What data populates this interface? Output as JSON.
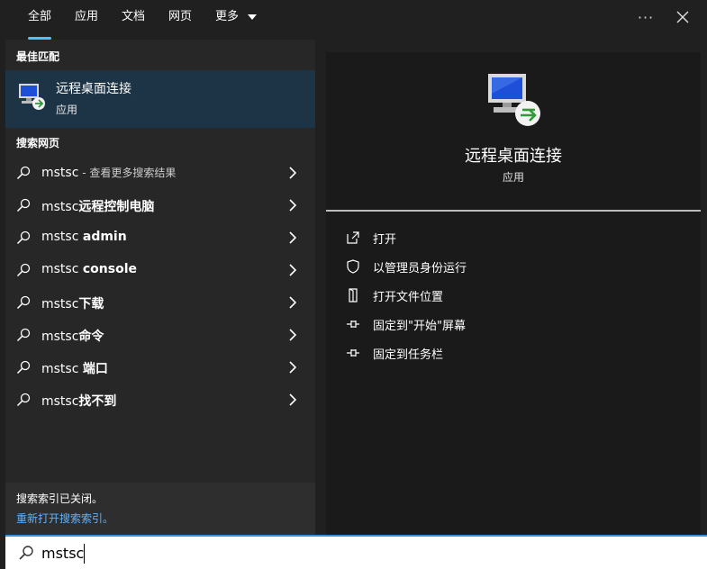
{
  "tabs": [
    {
      "label": "全部"
    },
    {
      "label": "应用"
    },
    {
      "label": "文档"
    },
    {
      "label": "网页"
    },
    {
      "label": "更多"
    }
  ],
  "top_actions": {
    "more": "···"
  },
  "best_match": {
    "section_title": "最佳匹配",
    "name": "远程桌面连接",
    "type": "应用"
  },
  "web": {
    "section_title": "搜索网页",
    "items": [
      {
        "query": "mstsc",
        "suffix": " - 查看更多搜索结果"
      },
      {
        "query": "mstsc",
        "bold": "远程控制电脑"
      },
      {
        "query": "mstsc ",
        "bold": "admin"
      },
      {
        "query": "mstsc ",
        "bold": "console"
      },
      {
        "query": "mstsc",
        "bold": "下载"
      },
      {
        "query": "mstsc",
        "bold": "命令"
      },
      {
        "query": "mstsc ",
        "bold": "端口"
      },
      {
        "query": "mstsc",
        "bold": "找不到"
      }
    ]
  },
  "footer": {
    "status": "搜索索引已关闭。",
    "link": "重新打开搜索索引。"
  },
  "detail": {
    "title": "远程桌面连接",
    "subtitle": "应用",
    "actions": [
      {
        "label": "打开",
        "icon": "open-external-icon"
      },
      {
        "label": "以管理员身份运行",
        "icon": "shield-icon"
      },
      {
        "label": "打开文件位置",
        "icon": "file-location-icon"
      },
      {
        "label": "固定到\"开始\"屏幕",
        "icon": "pin-icon"
      },
      {
        "label": "固定到任务栏",
        "icon": "pin-icon"
      }
    ]
  },
  "search": {
    "value": "mstsc"
  },
  "colors": {
    "accent": "#4cc2ff",
    "selected": "#1d3346",
    "link": "#5fb2ff"
  }
}
